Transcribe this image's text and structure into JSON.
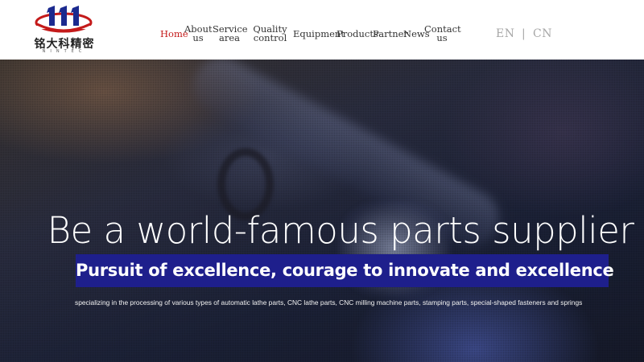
{
  "logo": {
    "chinese_name": "铭大科精密",
    "latin_name": "NINTEC"
  },
  "nav": [
    {
      "id": "home",
      "label": "Home",
      "active": true
    },
    {
      "id": "about",
      "label": "About us"
    },
    {
      "id": "service",
      "label": "Service area"
    },
    {
      "id": "quality",
      "label": "Quality control"
    },
    {
      "id": "equipment",
      "label": "Equipment"
    },
    {
      "id": "products",
      "label": "Products"
    },
    {
      "id": "partner",
      "label": "Partner"
    },
    {
      "id": "news",
      "label": "News"
    },
    {
      "id": "contact",
      "label": "Contact us"
    }
  ],
  "language": {
    "en": "EN",
    "separator": "|",
    "cn": "CN"
  },
  "hero": {
    "headline": "Be a world-famous parts supplier",
    "banner": "Pursuit of excellence, courage to innovate and excellence",
    "subtext": "specializing in the processing of various types of automatic lathe parts, CNC lathe parts, CNC milling machine parts, stamping parts, special-shaped fasteners and springs"
  },
  "colors": {
    "accent_red": "#c41a1a",
    "banner_blue": "#1e1f8c",
    "logo_blue": "#1b2a8f"
  }
}
